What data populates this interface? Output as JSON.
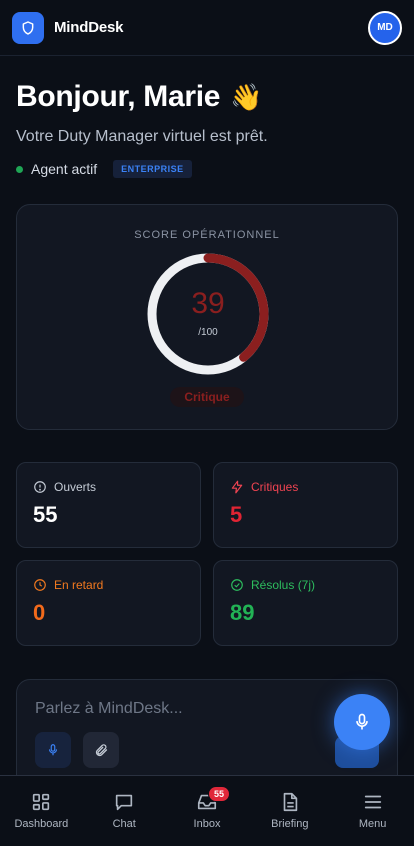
{
  "app": {
    "name": "MindDesk"
  },
  "user": {
    "initials": "MD"
  },
  "greeting": {
    "title": "Bonjour, Marie",
    "emoji": "👋",
    "subtitle": "Votre Duty Manager virtuel est prêt.",
    "status": "Agent actif",
    "plan": "ENTERPRISE"
  },
  "score": {
    "title": "SCORE OPÉRATIONNEL",
    "value": "39",
    "max": "/100",
    "fraction": 0.39,
    "label": "Critique"
  },
  "stats": [
    {
      "label": "Ouverts",
      "value": "55",
      "icon": "info-circle-icon",
      "color": "#ffffff",
      "label_color": "#c5ccd6"
    },
    {
      "label": "Critiques",
      "value": "5",
      "icon": "bolt-icon",
      "color": "#e02433",
      "label_color": "#f04452"
    },
    {
      "label": "En retard",
      "value": "0",
      "icon": "clock-icon",
      "color": "#f26a1b",
      "label_color": "#f2791f"
    },
    {
      "label": "Résolus (7j)",
      "value": "89",
      "icon": "check-circle-icon",
      "color": "#22b355",
      "label_color": "#2dbd5e"
    }
  ],
  "chat": {
    "placeholder": "Parlez à MindDesk..."
  },
  "nav": [
    {
      "label": "Dashboard",
      "icon": "grid-icon"
    },
    {
      "label": "Chat",
      "icon": "chat-icon"
    },
    {
      "label": "Inbox",
      "icon": "inbox-icon",
      "badge": "55"
    },
    {
      "label": "Briefing",
      "icon": "document-icon"
    },
    {
      "label": "Menu",
      "icon": "menu-icon"
    }
  ],
  "colors": {
    "accent": "#3b82f6",
    "critical": "#8b1f1f",
    "background": "#0b0f17"
  }
}
